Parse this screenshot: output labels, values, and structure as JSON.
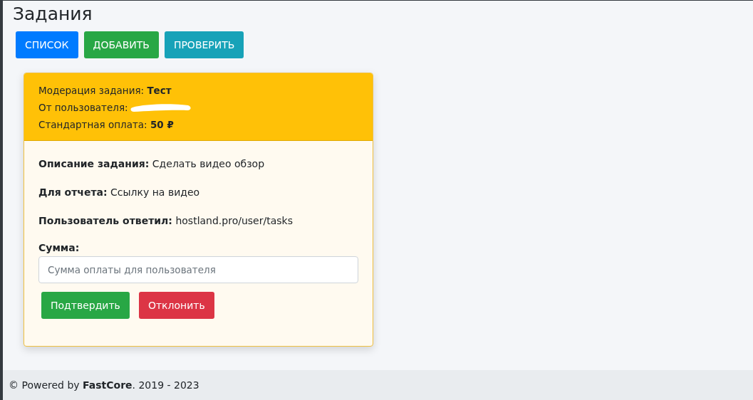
{
  "page_title": "Задания",
  "nav_buttons": [
    {
      "label": "СПИСОК",
      "kind": "primary"
    },
    {
      "label": "ДОБАВИТЬ",
      "kind": "success"
    },
    {
      "label": "ПРОВЕРИТЬ",
      "kind": "info"
    }
  ],
  "card": {
    "header_lines": [
      {
        "text": "Модерация задания: **Тест**",
        "redacted": false
      },
      {
        "text": "От пользователя:",
        "redacted": true
      },
      {
        "text": "Стандартная оплата: **50 ₽**",
        "redacted": false
      }
    ],
    "details": [
      "**Описание задания:** Сделать видео обзор",
      "**Для отчета:** Ссылку на видео",
      "**Пользователь ответил:** hostland.pro/user/tasks"
    ],
    "amount_label": "Сумма:",
    "amount_field": {
      "placeholder": "Сумма оплаты для пользователя"
    },
    "actions": [
      {
        "label": "Подтвердить",
        "kind": "success"
      },
      {
        "label": "Отклонить",
        "kind": "danger"
      }
    ]
  },
  "footer": "© Powered by **FastCore**. 2019 - 2023"
}
